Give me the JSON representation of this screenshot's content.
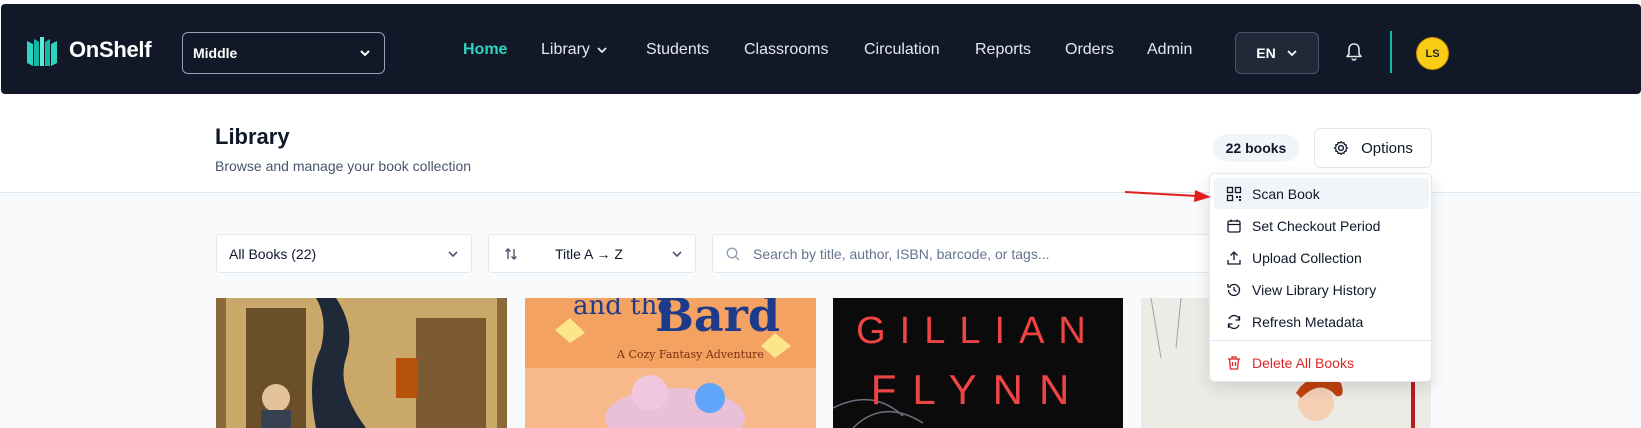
{
  "app": {
    "name": "OnShelf"
  },
  "school_select": {
    "value": "Middle"
  },
  "nav": {
    "items": [
      {
        "label": "Home",
        "active": true
      },
      {
        "label": "Library",
        "dropdown": true
      },
      {
        "label": "Students"
      },
      {
        "label": "Classrooms"
      },
      {
        "label": "Circulation"
      },
      {
        "label": "Reports"
      },
      {
        "label": "Orders"
      },
      {
        "label": "Admin"
      }
    ]
  },
  "language": {
    "value": "EN"
  },
  "user": {
    "initials": "LS"
  },
  "page": {
    "title": "Library",
    "subtitle": "Browse and manage your book collection",
    "count_badge": "22 books",
    "options_label": "Options"
  },
  "filters": {
    "collection": "All Books (22)",
    "sort": "Title A → Z",
    "search_placeholder": "Search by title, author, ISBN, barcode, or tags..."
  },
  "options_menu": {
    "items": [
      {
        "label": "Scan Book",
        "icon": "qr-icon",
        "highlighted": true
      },
      {
        "label": "Set Checkout Period",
        "icon": "calendar-icon"
      },
      {
        "label": "Upload Collection",
        "icon": "upload-icon"
      },
      {
        "label": "View Library History",
        "icon": "history-icon"
      },
      {
        "label": "Refresh Metadata",
        "icon": "refresh-icon"
      },
      {
        "label": "Delete All Books",
        "icon": "trash-icon",
        "danger": true
      }
    ]
  },
  "covers": {
    "book2_title_line1": "and the",
    "book2_title_line2": "Bard",
    "book2_subtitle": "A Cozy Fantasy Adventure",
    "book3_author_line1": "GILLIAN",
    "book3_author_line2": "FLYNN"
  },
  "colors": {
    "topbar": "#111827",
    "accent": "#2dd4bf",
    "danger": "#dc2626",
    "avatar": "#facc15",
    "annotation_arrow": "#e11d1d"
  }
}
